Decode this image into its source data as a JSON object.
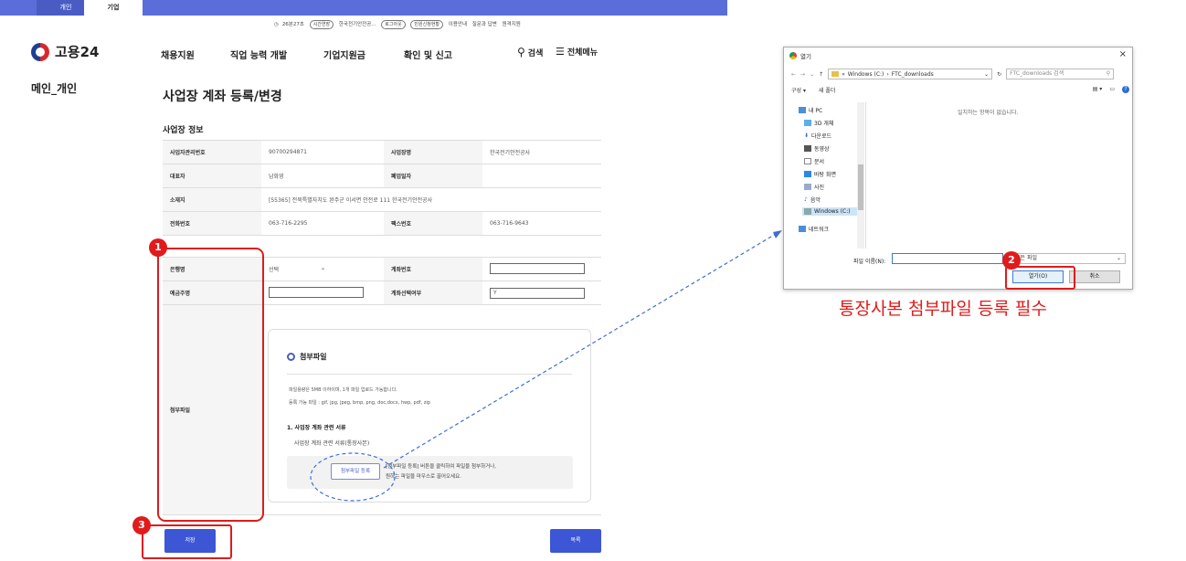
{
  "topbar": {
    "tab_personal": "개인",
    "tab_business": "기업"
  },
  "utility": {
    "timer": "26분27초",
    "extend": "시간연장",
    "user": "한국전기안전공...",
    "logout": "로그아웃",
    "civil": "민원신청현황",
    "guide": "이용안내",
    "faq": "질문과 답변",
    "remote": "원격지원"
  },
  "logo": {
    "text": "고용24"
  },
  "gnb": {
    "item1": "채용지원",
    "item2": "직업 능력 개발",
    "item3": "기업지원금",
    "item4": "확인 및 신고",
    "search": "검색",
    "menu": "전체메뉴"
  },
  "side": {
    "title": "메인_개인"
  },
  "page": {
    "title": "사업장 계좌 등록/변경",
    "section": "사업장 정보"
  },
  "info_table": {
    "r1": {
      "l1": "사업자관리번호",
      "v1": "90700294871",
      "l2": "사업장명",
      "v2": "한국전기안전공사"
    },
    "r2": {
      "l1": "대표자",
      "v1": "남화영",
      "l2": "폐업일자",
      "v2": ""
    },
    "r3": {
      "l1": "소재지",
      "v1": "[55365] 전북특별자치도 완주군 이서면 안전로 111 한국전기안전공사"
    },
    "r4": {
      "l1": "전화번호",
      "v1": "063-716-2295",
      "l2": "팩스번호",
      "v2": "063-716-9643"
    }
  },
  "account_table": {
    "bank_label": "은행명",
    "bank_value": "선택",
    "account_no_label": "계좌번호",
    "holder_label": "예금주명",
    "select_label": "계좌선택여부",
    "select_value": "Y",
    "attach_label": "첨부파일"
  },
  "attach": {
    "header": "첨부파일",
    "note1": "파일용량은 5MB 이하이며, 1개 파일 업로드 가능합니다.",
    "note2": "등록 가능 파일 : gif, jpg, jpeg, bmp, png, doc,docx, hwp, pdf, zip",
    "sub1": "1. 사업장 계좌 관련 서류",
    "sub2": "사업장 계좌 관련 서류(통장사본)",
    "button": "첨부파일 등록",
    "hint1": "[첨부파일 등록] 버튼을 클릭하여 파일을 첨부하거나,",
    "hint2": "원하는 파일을 마우스로 끌어오세요."
  },
  "buttons": {
    "save": "저장",
    "list": "목록"
  },
  "badges": {
    "b1": "1",
    "b2": "2",
    "b3": "3"
  },
  "dialog": {
    "title": "열기",
    "path_prefix": "«",
    "path1": "Windows (C:)",
    "path2": "FTC_downloads",
    "search_placeholder": "FTC_downloads 검색",
    "organize": "구성 ▾",
    "new_folder": "새 폴더",
    "tree": [
      "내 PC",
      "3D 개체",
      "다운로드",
      "동영상",
      "문서",
      "바탕 화면",
      "사진",
      "음악",
      "Windows (C:)",
      "네트워크"
    ],
    "empty": "일치하는 항목이 없습니다.",
    "filename_label": "파일 이름(N):",
    "filetype": "모든 파일",
    "open": "열기(O)",
    "cancel": "취소"
  },
  "caption": "통장사본 첨부파일 등록 필수",
  "colors": {
    "accent": "#3d56d6",
    "annotation": "#e01b1b",
    "topbar": "#5a6dd8"
  }
}
